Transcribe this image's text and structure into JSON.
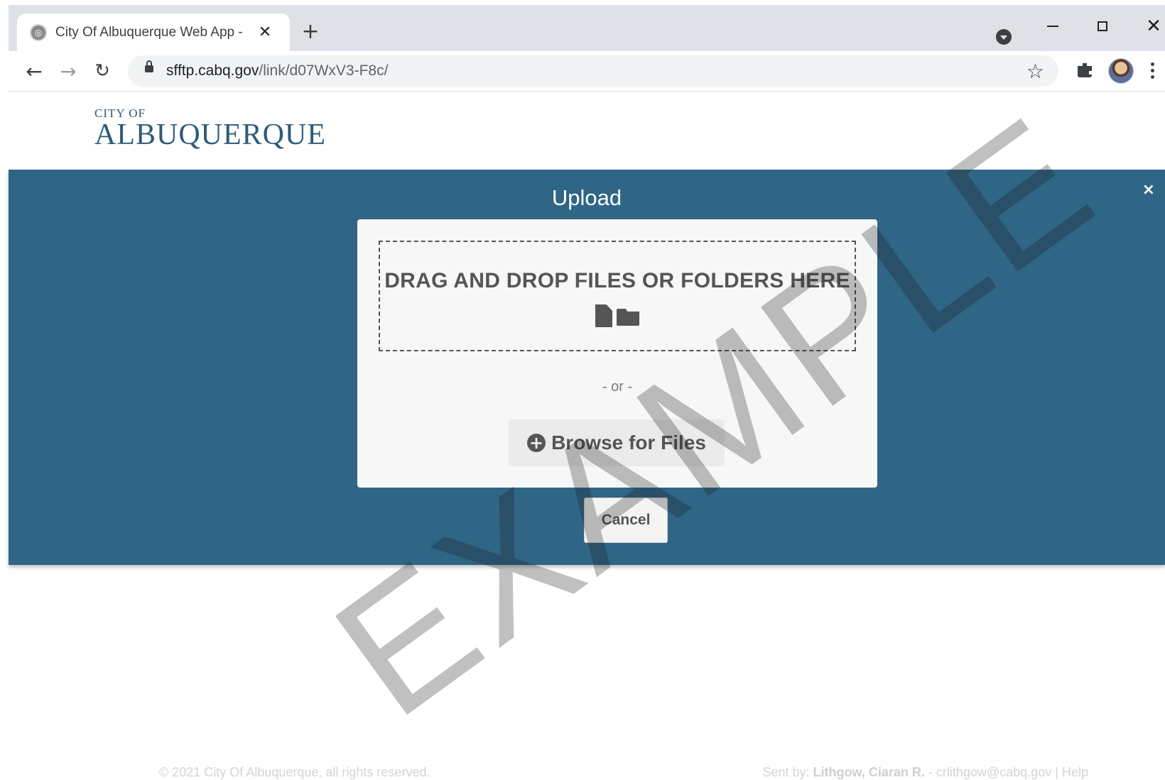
{
  "browser": {
    "tab_title": "City Of Albuquerque Web App - I",
    "tab_close": "✕",
    "new_tab": "+",
    "url_host": "sfftp.cabq.gov",
    "url_path": "/link/d07WxV3-F8c/",
    "window_close": "✕"
  },
  "logo": {
    "small": "CITY OF",
    "big": "ALBUQUERQUE"
  },
  "upload": {
    "title": "Upload",
    "close": "×",
    "dropzone_text": "DRAG AND DROP FILES OR FOLDERS HERE",
    "or_text": "- or -",
    "browse_label": "Browse for Files",
    "cancel_label": "Cancel"
  },
  "footer": {
    "copyright": "© 2021 City Of Albuquerque, all rights reserved.",
    "sent_by_label": "Sent by:",
    "sender": "Lithgow, Ciaran R.",
    "sender_email": "- crlithgow@cabq.gov",
    "separator": "|",
    "help": "Help"
  },
  "watermark": "EXAMPLE",
  "colors": {
    "banner": "#2f6585",
    "card": "#f7f7f7",
    "chrome": "#dee1e6"
  }
}
